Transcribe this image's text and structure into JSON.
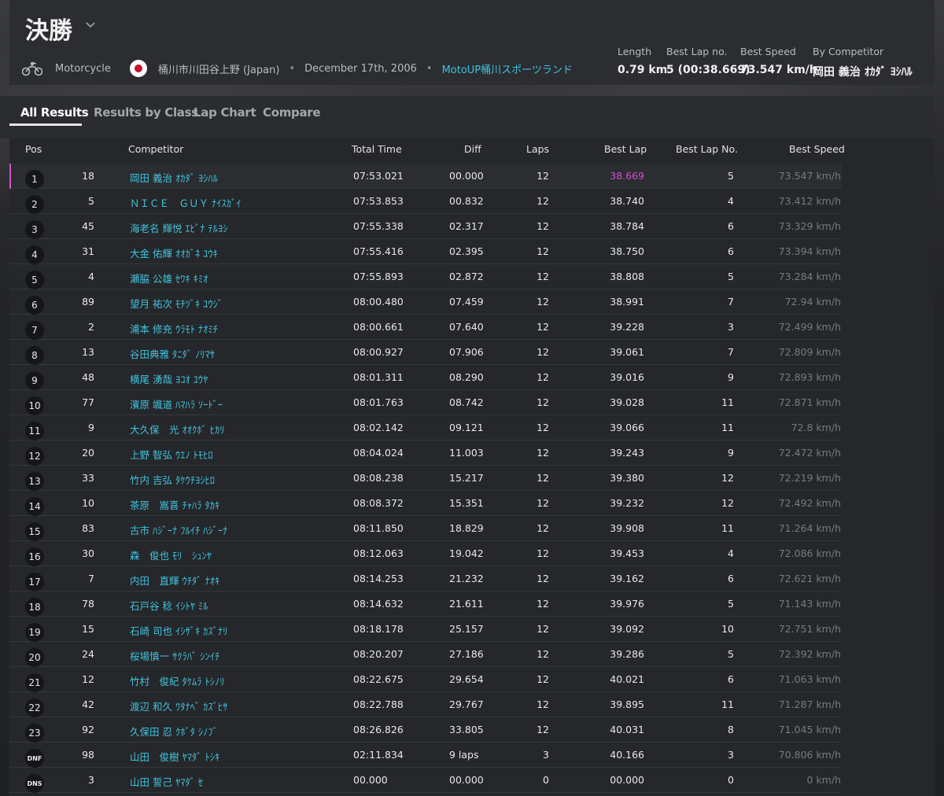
{
  "header": {
    "title": "決勝",
    "sport": "Motorcycle",
    "location": "桶川市川田谷上野 (Japan)",
    "date": "December 17th, 2006",
    "venue": "MotoUP桶川スポーツランド",
    "separator": "•",
    "country_flag": "japan",
    "stats": {
      "length_label": "Length",
      "length_value": "0.79 km",
      "bestlap_label": "Best Lap no.",
      "bestlap_value": "5 (00:38.669)",
      "bestspeed_label": "Best Speed",
      "bestspeed_value": "73.547 km/h",
      "bycomp_label": "By Competitor",
      "bycomp_value": "岡田 義治 ｵｶﾀﾞ ﾖｼﾊﾙ"
    }
  },
  "tabs": [
    {
      "label": "All Results",
      "active": true
    },
    {
      "label": "Results by Class",
      "active": false
    },
    {
      "label": "Lap Chart",
      "active": false
    },
    {
      "label": "Compare",
      "active": false
    }
  ],
  "columns": {
    "pos": "Pos",
    "competitor": "Competitor",
    "total": "Total Time",
    "diff": "Diff",
    "laps": "Laps",
    "best": "Best Lap",
    "bestno": "Best Lap No.",
    "speed": "Best Speed"
  },
  "colors": {
    "accent": "#41c3dc",
    "highlight": "#d14fd0"
  },
  "rows": [
    {
      "pos": "1",
      "num": "18",
      "name": "岡田 義治 ｵｶﾀﾞ ﾖｼﾊﾙ",
      "total": "07:53.021",
      "diff": "00.000",
      "laps": "12",
      "best": "38.669",
      "bestno": "5",
      "speed": "73.547 km/h"
    },
    {
      "pos": "2",
      "num": "5",
      "name": "ＮＩＣＥ　ＧＵＹ ﾅｲｽｶﾞｲ",
      "total": "07:53.853",
      "diff": "00.832",
      "laps": "12",
      "best": "38.740",
      "bestno": "4",
      "speed": "73.412 km/h"
    },
    {
      "pos": "3",
      "num": "45",
      "name": "海老名 輝悦 ｴﾋﾞﾅ ﾃﾙﾖｼ",
      "total": "07:55.338",
      "diff": "02.317",
      "laps": "12",
      "best": "38.784",
      "bestno": "6",
      "speed": "73.329 km/h"
    },
    {
      "pos": "4",
      "num": "31",
      "name": "大金 佑輝 ｵｵｶﾞﾈ ﾕｳｷ",
      "total": "07:55.416",
      "diff": "02.395",
      "laps": "12",
      "best": "38.750",
      "bestno": "6",
      "speed": "73.394 km/h"
    },
    {
      "pos": "5",
      "num": "4",
      "name": "瀬脇 公雄 ｾﾜｷ ｷﾐｵ",
      "total": "07:55.893",
      "diff": "02.872",
      "laps": "12",
      "best": "38.808",
      "bestno": "5",
      "speed": "73.284 km/h"
    },
    {
      "pos": "6",
      "num": "89",
      "name": "望月 祐次 ﾓﾁﾂﾞｷ ﾕｳｼﾞ",
      "total": "08:00.480",
      "diff": "07.459",
      "laps": "12",
      "best": "38.991",
      "bestno": "7",
      "speed": "72.94 km/h"
    },
    {
      "pos": "7",
      "num": "2",
      "name": "浦本 修充 ｳﾗﾓﾄ ﾅｵﾐﾁ",
      "total": "08:00.661",
      "diff": "07.640",
      "laps": "12",
      "best": "39.228",
      "bestno": "3",
      "speed": "72.499 km/h"
    },
    {
      "pos": "8",
      "num": "13",
      "name": "谷田典雅 ﾀﾆﾀﾞ ﾉﾘﾏｻ",
      "total": "08:00.927",
      "diff": "07.906",
      "laps": "12",
      "best": "39.061",
      "bestno": "7",
      "speed": "72.809 km/h"
    },
    {
      "pos": "9",
      "num": "48",
      "name": "横尾 湧哉 ﾖｺｵ ﾕｳﾔ",
      "total": "08:01.311",
      "diff": "08.290",
      "laps": "12",
      "best": "39.016",
      "bestno": "9",
      "speed": "72.893 km/h"
    },
    {
      "pos": "10",
      "num": "77",
      "name": "濱原 颯道 ﾊﾏﾊﾗ ｿｰﾄﾞｰ",
      "total": "08:01.763",
      "diff": "08.742",
      "laps": "12",
      "best": "39.028",
      "bestno": "11",
      "speed": "72.871 km/h"
    },
    {
      "pos": "11",
      "num": "9",
      "name": "大久保　光 ｵｵｸﾎﾞ ﾋｶﾘ",
      "total": "08:02.142",
      "diff": "09.121",
      "laps": "12",
      "best": "39.066",
      "bestno": "11",
      "speed": "72.8 km/h"
    },
    {
      "pos": "12",
      "num": "20",
      "name": "上野 智弘 ｳｴﾉ ﾄﾓﾋﾛ",
      "total": "08:04.024",
      "diff": "11.003",
      "laps": "12",
      "best": "39.243",
      "bestno": "9",
      "speed": "72.472 km/h"
    },
    {
      "pos": "13",
      "num": "33",
      "name": "竹内 吉弘 ﾀｹｳﾁﾖｼﾋﾛ",
      "total": "08:08.238",
      "diff": "15.217",
      "laps": "12",
      "best": "39.380",
      "bestno": "12",
      "speed": "72.219 km/h"
    },
    {
      "pos": "14",
      "num": "10",
      "name": "茶原　嵩喜 ﾁｬﾊﾗ ﾀｶｷ",
      "total": "08:08.372",
      "diff": "15.351",
      "laps": "12",
      "best": "39.232",
      "bestno": "12",
      "speed": "72.492 km/h"
    },
    {
      "pos": "15",
      "num": "83",
      "name": "古市 ﾊｼﾞｰﾅ ﾌﾙｲﾁ ﾊｼﾞｰﾅ",
      "total": "08:11.850",
      "diff": "18.829",
      "laps": "12",
      "best": "39.908",
      "bestno": "11",
      "speed": "71.264 km/h"
    },
    {
      "pos": "16",
      "num": "30",
      "name": "森　俊也 ﾓﾘ　ｼｭﾝﾔ",
      "total": "08:12.063",
      "diff": "19.042",
      "laps": "12",
      "best": "39.453",
      "bestno": "4",
      "speed": "72.086 km/h"
    },
    {
      "pos": "17",
      "num": "7",
      "name": "内田　直輝 ｳﾁﾀﾞ ﾅｵｷ",
      "total": "08:14.253",
      "diff": "21.232",
      "laps": "12",
      "best": "39.162",
      "bestno": "6",
      "speed": "72.621 km/h"
    },
    {
      "pos": "18",
      "num": "78",
      "name": "石戸谷 稔 ｲｼﾄﾔ ﾐﾙ",
      "total": "08:14.632",
      "diff": "21.611",
      "laps": "12",
      "best": "39.976",
      "bestno": "5",
      "speed": "71.143 km/h"
    },
    {
      "pos": "19",
      "num": "15",
      "name": "石崎 司也 ｲｼｻﾞｷ ｶｽﾞﾅﾘ",
      "total": "08:18.178",
      "diff": "25.157",
      "laps": "12",
      "best": "39.092",
      "bestno": "10",
      "speed": "72.751 km/h"
    },
    {
      "pos": "20",
      "num": "24",
      "name": "桜場慎一 ｻｸﾗﾊﾞ ｼﾝｲﾁ",
      "total": "08:20.207",
      "diff": "27.186",
      "laps": "12",
      "best": "39.286",
      "bestno": "5",
      "speed": "72.392 km/h"
    },
    {
      "pos": "21",
      "num": "12",
      "name": "竹村　俊紀 ﾀｹﾑﾗ ﾄｼﾉﾘ",
      "total": "08:22.675",
      "diff": "29.654",
      "laps": "12",
      "best": "40.021",
      "bestno": "6",
      "speed": "71.063 km/h"
    },
    {
      "pos": "22",
      "num": "42",
      "name": "渡辺 和久 ﾜﾀﾅﾍﾞ ｶｽﾞﾋｻ",
      "total": "08:22.788",
      "diff": "29.767",
      "laps": "12",
      "best": "39.895",
      "bestno": "11",
      "speed": "71.287 km/h"
    },
    {
      "pos": "23",
      "num": "92",
      "name": "久保田 忍 ｸﾎﾞﾀ ｼﾉﾌﾞ",
      "total": "08:26.826",
      "diff": "33.805",
      "laps": "12",
      "best": "40.031",
      "bestno": "8",
      "speed": "71.045 km/h"
    },
    {
      "pos": "DNF",
      "num": "98",
      "name": "山田　俊樹 ﾔﾏﾀﾞ ﾄｼｷ",
      "total": "02:11.834",
      "diff": "9 laps",
      "laps": "3",
      "best": "40.166",
      "bestno": "3",
      "speed": "70.806 km/h"
    },
    {
      "pos": "DNS",
      "num": "3",
      "name": "山田 誓己 ﾔﾏﾀﾞ ｾ",
      "total": "00.000",
      "diff": "00.000",
      "laps": "0",
      "best": "00.000",
      "bestno": "0",
      "speed": "0 km/h"
    }
  ]
}
